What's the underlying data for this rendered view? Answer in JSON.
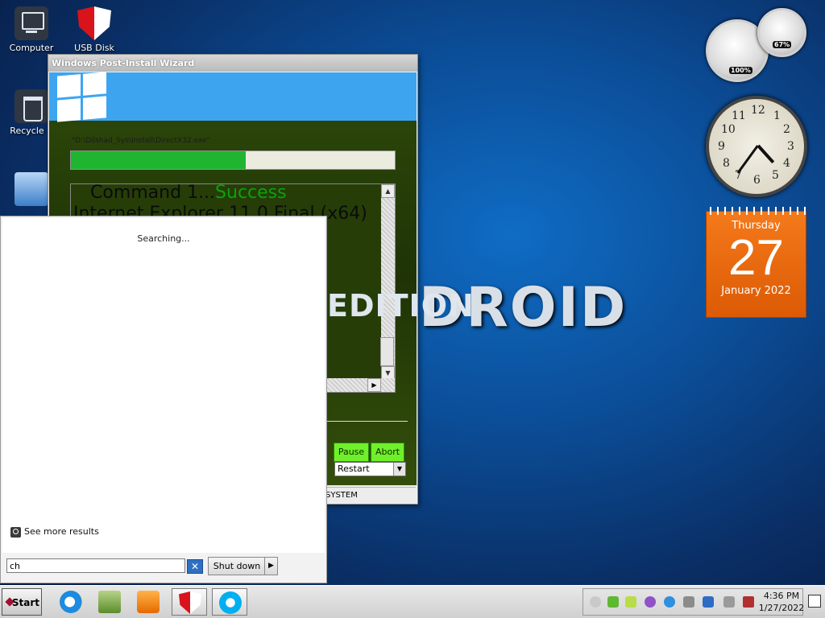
{
  "desktop": {
    "icons": [
      {
        "label": "Computer",
        "icon": "computer-icon"
      },
      {
        "label": "USB Disk",
        "icon": "shield-icon"
      },
      {
        "label": "Recycle B",
        "icon": "recycle-bin-icon"
      },
      {
        "label": "",
        "icon": "computer-search-icon"
      }
    ],
    "wallpaper_text": "DROID"
  },
  "wizard": {
    "title": "Windows Post-Install Wizard",
    "current_path": "\"D:\\Dilshad_Sys\\Install\\DirectX32.exe\"",
    "progress_fraction": 0.54,
    "log_line_1_prefix": "Command 1...",
    "log_line_1_status": "Success",
    "log_line_2": "Internet Explorer 11.0 Final (x64)",
    "edition_text": "EDITION",
    "pause_label": "Pause",
    "abort_label": "Abort",
    "restart_option": "Restart",
    "status_text": "SYSTEM"
  },
  "start_menu": {
    "searching_text": "Searching...",
    "see_more_label": "See more results",
    "search_value": "ch",
    "clear_label": "✕",
    "shutdown_label": "Shut down",
    "shutdown_arrow": "▶"
  },
  "gadgets": {
    "cpu_meter_left": "100%",
    "cpu_meter_right": "67%",
    "clock_numbers": [
      "12",
      "1",
      "2",
      "3",
      "4",
      "5",
      "6",
      "7",
      "8",
      "9",
      "10",
      "11"
    ],
    "calendar": {
      "weekday": "Thursday",
      "day": "27",
      "month_year": "January 2022"
    }
  },
  "taskbar": {
    "start_label": "Start",
    "pinned": [
      "internet-explorer-icon",
      "file-explorer-icon",
      "media-player-icon",
      "shield-app-icon",
      "skype-icon"
    ],
    "time": "4:36 PM",
    "date": "1/27/2022"
  },
  "colors": {
    "accent_blue": "#3da5f0",
    "progress_green": "#1fb531",
    "button_green": "#6ff02a",
    "calendar_orange": "#f47a1a"
  }
}
